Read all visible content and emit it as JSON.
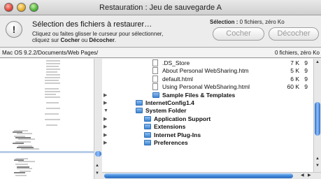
{
  "window": {
    "title": "Restauration : Jeu de sauvegarde A"
  },
  "info": {
    "heading": "Sélection des fichiers à restaurer…",
    "line1": "Cliquez ou faites glisser le curseur pour sélectionner,",
    "line2_prefix": "cliquez sur ",
    "line2_cocher": "Cocher",
    "line2_mid": " ou ",
    "line2_decocher": "Décocher",
    "line2_suffix": ".",
    "selection_label": "Sélection :",
    "selection_value": " 0 fichiers, zéro Ko",
    "cocher_label": "Cocher",
    "decocher_label": "Décocher"
  },
  "pathbar": {
    "path": "Mac OS 9.2.2/Documents/Web Pages/",
    "count": "0 fichiers, zéro Ko"
  },
  "list": [
    {
      "name": ".DS_Store",
      "size": "7 K",
      "extra": "9",
      "kind": "file",
      "tri": false
    },
    {
      "name": "About Personal WebSharing.htm",
      "size": "5 K",
      "extra": "9",
      "kind": "file",
      "tri": false
    },
    {
      "name": "default.html",
      "size": "6 K",
      "extra": "9",
      "kind": "file",
      "tri": false
    },
    {
      "name": "Using Personal WebSharing.html",
      "size": "60 K",
      "extra": "9",
      "kind": "file",
      "tri": false
    },
    {
      "name": "Sample Files & Templates",
      "size": "",
      "extra": "",
      "kind": "folder",
      "tri": "right"
    },
    {
      "name": "InternetConfig1.4",
      "size": "",
      "extra": "",
      "kind": "folder",
      "tri": "right"
    },
    {
      "name": "System Folder",
      "size": "",
      "extra": "",
      "kind": "folder",
      "tri": "down"
    },
    {
      "name": "Application Support",
      "size": "",
      "extra": "",
      "kind": "folder",
      "tri": "right"
    },
    {
      "name": "Extensions",
      "size": "",
      "extra": "",
      "kind": "folder",
      "tri": "right"
    },
    {
      "name": "Internet Plug-Ins",
      "size": "",
      "extra": "",
      "kind": "folder",
      "tri": "right"
    },
    {
      "name": "Preferences",
      "size": "",
      "extra": "",
      "kind": "folder",
      "tri": "right"
    }
  ],
  "icons": {
    "close": "close-icon",
    "minimize": "minimize-icon",
    "zoom": "zoom-icon",
    "info": "exclamation-icon",
    "file": "document-icon",
    "folder": "folder-icon",
    "disclosure": "disclosure-triangle-icon"
  },
  "colors": {
    "accent": "#3f86d6",
    "selection_band": "#b9cde8"
  }
}
